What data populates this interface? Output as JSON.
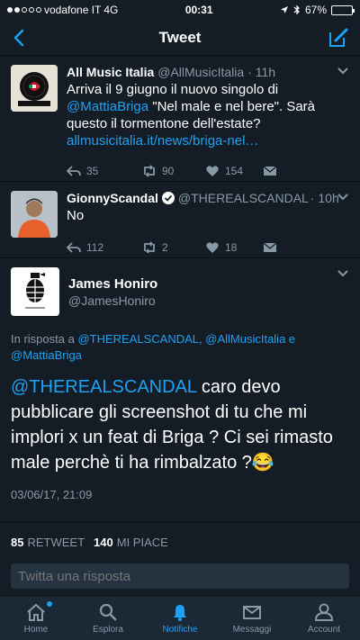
{
  "status_bar": {
    "carrier": "vodafone IT",
    "network": "4G",
    "time": "00:31",
    "battery": "67%",
    "battery_level": 0.67
  },
  "nav": {
    "title": "Tweet"
  },
  "tweets": [
    {
      "name": "All Music Italia",
      "handle": "@AllMusicItalia",
      "time": "· 11h",
      "text_1": "Arriva il 9 giugno il nuovo singolo di",
      "mention": "@MattiaBriga",
      "text_2": " \"Nel male e nel bere\". Sarà questo il tormentone dell'estate?",
      "link": "allmusicitalia.it/news/briga-nel…",
      "replies": "35",
      "retweets": "90",
      "likes": "154"
    },
    {
      "name": "GionnyScandal",
      "handle": "@THEREALSCANDAL",
      "time": "· 10h",
      "text": "No",
      "replies": "112",
      "retweets": "2",
      "likes": "18"
    }
  ],
  "detail": {
    "name": "James Honiro",
    "handle": "@JamesHoniro",
    "reply_prefix": "In risposta a ",
    "reply_mention_1": "@THEREALSCANDAL",
    "reply_sep": ", ",
    "reply_mention_2": "@AllMusicItalia",
    "reply_and": " e ",
    "reply_mention_3": "@MattiaBriga",
    "mention": "@THEREALSCANDAL",
    "text": " caro devo pubblicare gli screenshot di tu che mi implori x un feat di Briga ? Ci sei rimasto male perchè ti ha rimbalzato ?😂",
    "timestamp": "03/06/17, 21:09",
    "retweet_count": "85",
    "retweet_label": "RETWEET",
    "like_count": "140",
    "like_label": "MI PIACE"
  },
  "reply": {
    "placeholder": "Twitta una risposta"
  },
  "tabs": [
    {
      "label": "Home"
    },
    {
      "label": "Esplora"
    },
    {
      "label": "Notifiche"
    },
    {
      "label": "Messaggi"
    },
    {
      "label": "Account"
    }
  ],
  "colors": {
    "background": "#141d26",
    "accent": "#1da1f2",
    "muted": "#8899a6",
    "tabbar": "#1b2836"
  }
}
